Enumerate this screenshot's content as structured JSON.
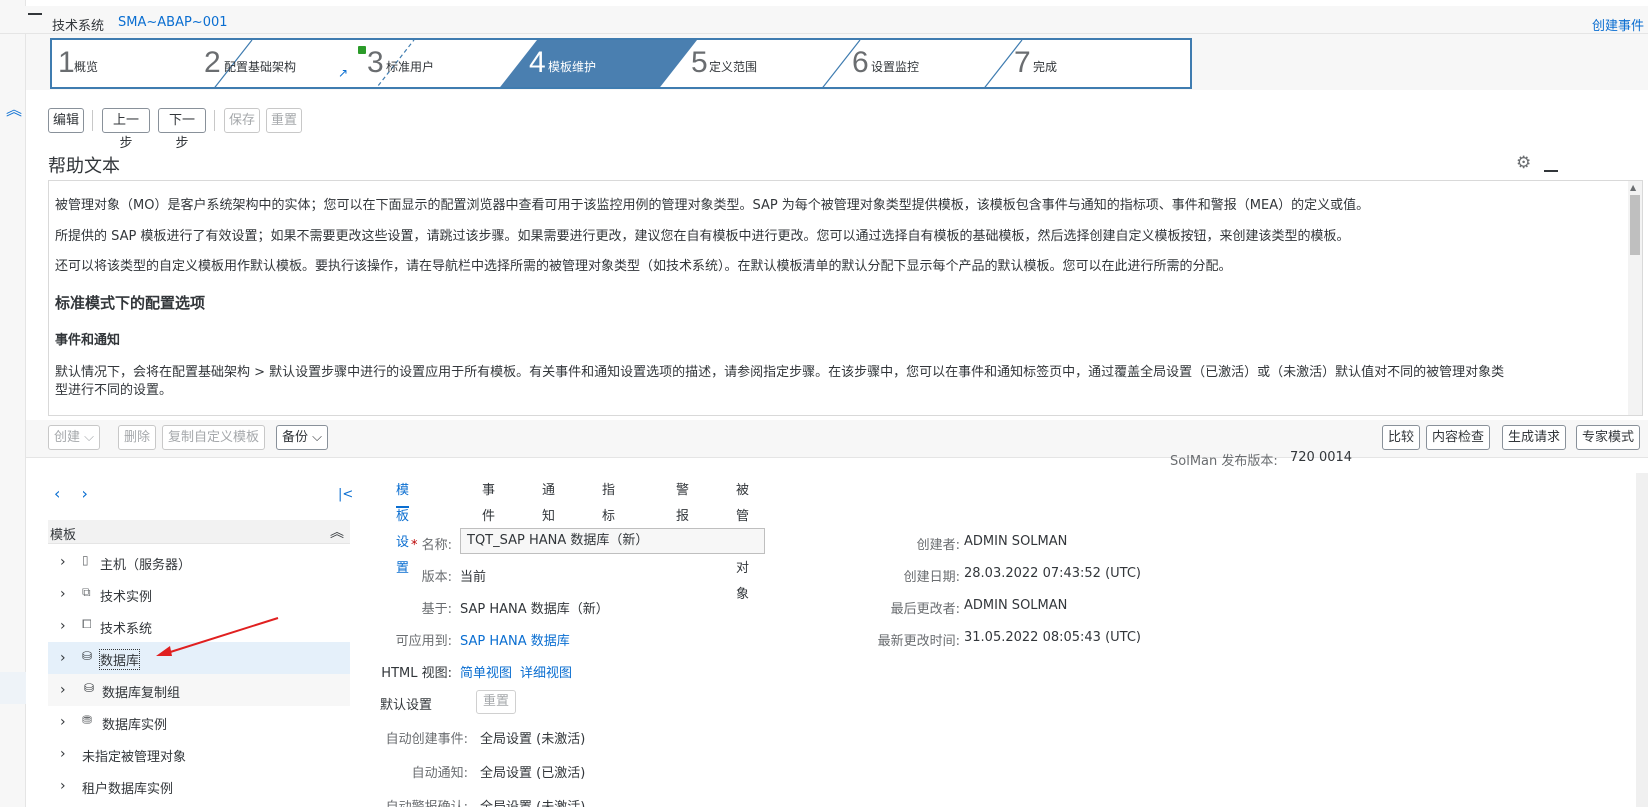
{
  "header": {
    "label": "技术系统",
    "value": "SMA~ABAP~001",
    "create_event": "创建事件"
  },
  "wizard": {
    "steps": [
      {
        "num": "1",
        "label": "概览"
      },
      {
        "num": "2",
        "label": "配置基础架构"
      },
      {
        "num": "3",
        "label": "标准用户"
      },
      {
        "num": "4",
        "label": "模板维护"
      },
      {
        "num": "5",
        "label": "定义范围"
      },
      {
        "num": "6",
        "label": "设置监控"
      },
      {
        "num": "7",
        "label": "完成"
      }
    ],
    "active_index": 3,
    "colors": {
      "active": "#4a7fb0",
      "border": "#3f7cb0",
      "status_dot": "#2b9b29"
    }
  },
  "toolbar": {
    "edit": "编辑",
    "prev": "上一步",
    "next": "下一步",
    "save": "保存",
    "reset": "重置"
  },
  "help": {
    "title": "帮助文本",
    "p1": "被管理对象（MO）是客户系统架构中的实体；您可以在下面显示的配置浏览器中查看可用于该监控用例的管理对象类型。SAP 为每个被管理对象类型提供模板，该模板包含事件与通知的指标项、事件和警报（MEA）的定义或值。",
    "p2": "所提供的 SAP 模板进行了有效设置；如果不需要更改这些设置，请跳过该步骤。如果需要进行更改，建议您在自有模板中进行更改。您可以通过选择自有模板的基础模板，然后选择创建自定义模板按钮，来创建该类型的模板。",
    "p3": "还可以将该类型的自定义模板用作默认模板。要执行该操作，请在导航栏中选择所需的被管理对象类型（如技术系统）。在默认模板清单的默认分配下显示每个产品的默认模板。您可以在此进行所需的分配。",
    "h1": "标准模式下的配置选项",
    "h2": "事件和通知",
    "p4a": "默认情况下，会将在配置基础架构 > 默认设置步骤中进行的设置应用于所有模板。有关事件和通知设置选项的描述，请参阅指定步骤。在该步骤中，您可以在事件和通知标签页中，通过覆盖全局设置（已激活）或（未激活）默认值对不同的被管理对象类",
    "p4b": "型进行不同的设置。"
  },
  "lower_toolbar": {
    "create": "创建",
    "delete": "删除",
    "copy_custom": "复制自定义模板",
    "backup": "备份",
    "release_label": "SolMan 发布版本:",
    "release_value": "720 0014",
    "compare": "比较",
    "content_check": "内容检查",
    "generate_request": "生成请求",
    "expert_mode": "专家模式"
  },
  "tree": {
    "header": "模板",
    "items": [
      {
        "label": "主机（服务器）",
        "icon": "host-icon"
      },
      {
        "label": "技术实例",
        "icon": "instance-icon"
      },
      {
        "label": "技术系统",
        "icon": "system-icon"
      },
      {
        "label": "数据库",
        "icon": "database-icon"
      },
      {
        "label": "数据库复制组",
        "icon": "database-icon"
      },
      {
        "label": "数据库实例",
        "icon": "db-instance-icon"
      },
      {
        "label": "未指定被管理对象",
        "icon": ""
      },
      {
        "label": "租户数据库实例",
        "icon": ""
      }
    ],
    "selected_index": 3
  },
  "tabs": [
    "模板设置",
    "事件",
    "通知",
    "指标项",
    "警报",
    "被管理对象"
  ],
  "details": {
    "name_label": "名称:",
    "name_value": "TQT_SAP HANA 数据库（新）",
    "version_label": "版本:",
    "version_value": "当前",
    "based_on_label": "基于:",
    "based_on_value": "SAP HANA 数据库（新）",
    "applicable_label": "可应用到:",
    "applicable_value": "SAP HANA 数据库",
    "html_view_label": "HTML 视图:",
    "simple_view": "简单视图",
    "detail_view": "详细视图",
    "default_label": "默认设置",
    "reset": "重置",
    "auto_event_label": "自动创建事件:",
    "auto_event_value": "全局设置 (未激活)",
    "auto_notify_label": "自动通知:",
    "auto_notify_value": "全局设置 (已激活)",
    "auto_alert_label": "自动警报确认:",
    "auto_alert_value": "全局设置 (未激活)",
    "creator_label": "创建者:",
    "creator_value": "ADMIN SOLMAN",
    "created_label": "创建日期:",
    "created_value": "28.03.2022 07:43:52 (UTC)",
    "changed_by_label": "最后更改者:",
    "changed_by_value": "ADMIN SOLMAN",
    "changed_label": "最新更改时间:",
    "changed_value": "31.05.2022 08:05:43 (UTC)"
  }
}
